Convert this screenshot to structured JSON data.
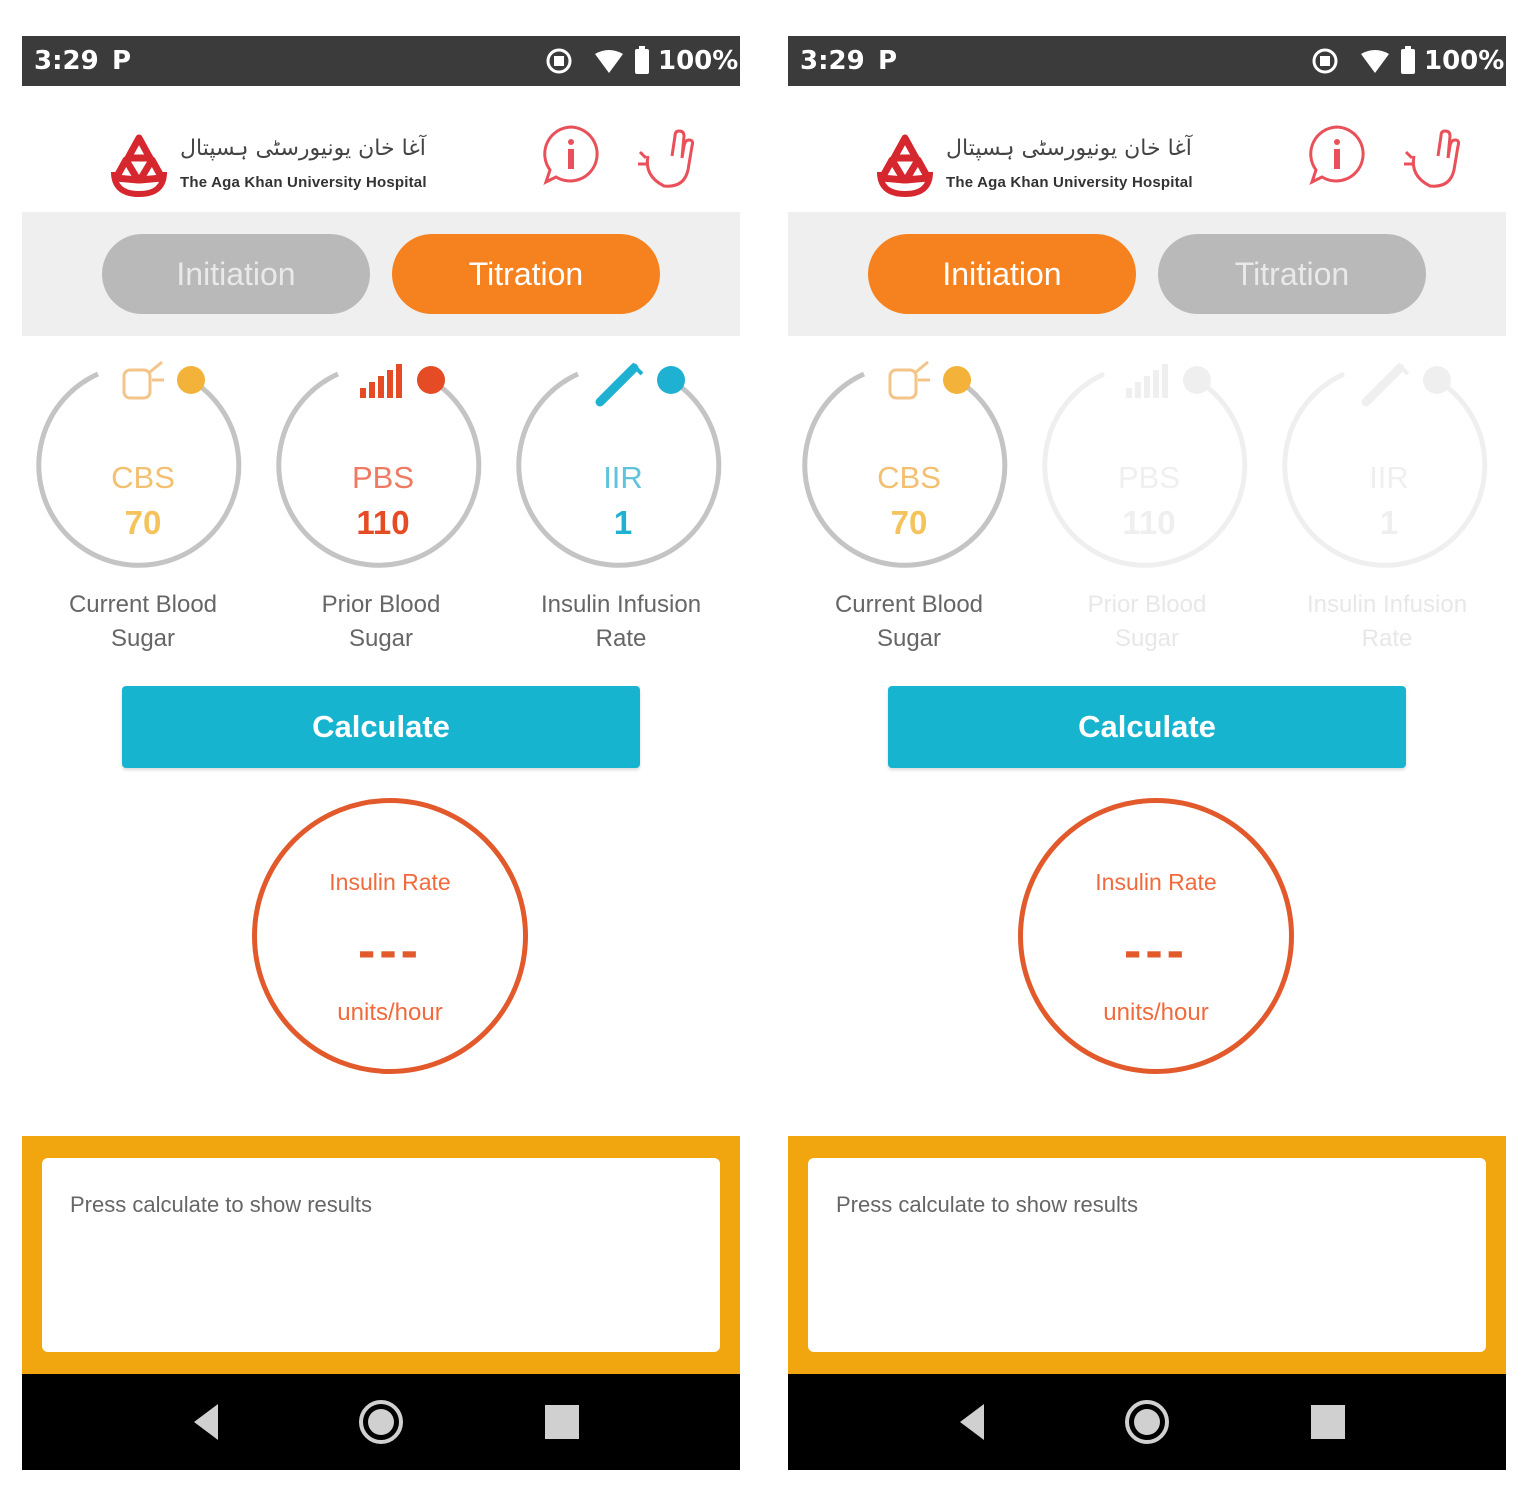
{
  "colors": {
    "accent_orange": "#f5821f",
    "tab_inactive": "#b9b9b9",
    "calculate_blue": "#17b4d0",
    "rate_red": "#e25a2c",
    "panel_yellow": "#f1a60f",
    "cbs_color": "#f3b23a",
    "pbs_color": "#e54b24",
    "iir_color": "#1fb1d1"
  },
  "screens": [
    {
      "status": {
        "time": "3:29",
        "notification": "P",
        "battery": "100%",
        "icons": [
          "rotation-lock-icon",
          "wifi-icon",
          "battery-icon"
        ]
      },
      "header": {
        "logo_arabic": "آغا خان يونيورسٹی ہسپتال",
        "logo_text": "The Aga Khan University Hospital",
        "icons": [
          "info-icon",
          "hand-icon"
        ]
      },
      "tabs": [
        {
          "label": "Initiation",
          "active": false
        },
        {
          "label": "Titration",
          "active": true
        }
      ],
      "gauges": [
        {
          "abbr": "CBS",
          "value": "70",
          "label_line1": "Current Blood",
          "label_line2": "Sugar",
          "icon": "glucometer-icon",
          "enabled": true
        },
        {
          "abbr": "PBS",
          "value": "110",
          "label_line1": "Prior Blood",
          "label_line2": "Sugar",
          "icon": "bar-chart-icon",
          "enabled": true
        },
        {
          "abbr": "IIR",
          "value": "1",
          "label_line1": "Insulin Infusion",
          "label_line2": "Rate",
          "icon": "syringe-icon",
          "enabled": true
        }
      ],
      "calculate_label": "Calculate",
      "rate": {
        "title": "Insulin Rate",
        "value": "---",
        "unit": "units/hour"
      },
      "result_text": "Press calculate to show results",
      "nav": [
        "back-icon",
        "home-icon",
        "recents-icon"
      ]
    },
    {
      "status": {
        "time": "3:29",
        "notification": "P",
        "battery": "100%",
        "icons": [
          "rotation-lock-icon",
          "wifi-icon",
          "battery-icon"
        ]
      },
      "header": {
        "logo_arabic": "آغا خان يونيورسٹی ہسپتال",
        "logo_text": "The Aga Khan University Hospital",
        "icons": [
          "info-icon",
          "hand-icon"
        ]
      },
      "tabs": [
        {
          "label": "Initiation",
          "active": true
        },
        {
          "label": "Titration",
          "active": false
        }
      ],
      "gauges": [
        {
          "abbr": "CBS",
          "value": "70",
          "label_line1": "Current Blood",
          "label_line2": "Sugar",
          "icon": "glucometer-icon",
          "enabled": true
        },
        {
          "abbr": "PBS",
          "value": "110",
          "label_line1": "Prior Blood",
          "label_line2": "Sugar",
          "icon": "bar-chart-icon",
          "enabled": false
        },
        {
          "abbr": "IIR",
          "value": "1",
          "label_line1": "Insulin Infusion",
          "label_line2": "Rate",
          "icon": "syringe-icon",
          "enabled": false
        }
      ],
      "calculate_label": "Calculate",
      "rate": {
        "title": "Insulin Rate",
        "value": "---",
        "unit": "units/hour"
      },
      "result_text": "Press calculate to show results",
      "nav": [
        "back-icon",
        "home-icon",
        "recents-icon"
      ]
    }
  ]
}
